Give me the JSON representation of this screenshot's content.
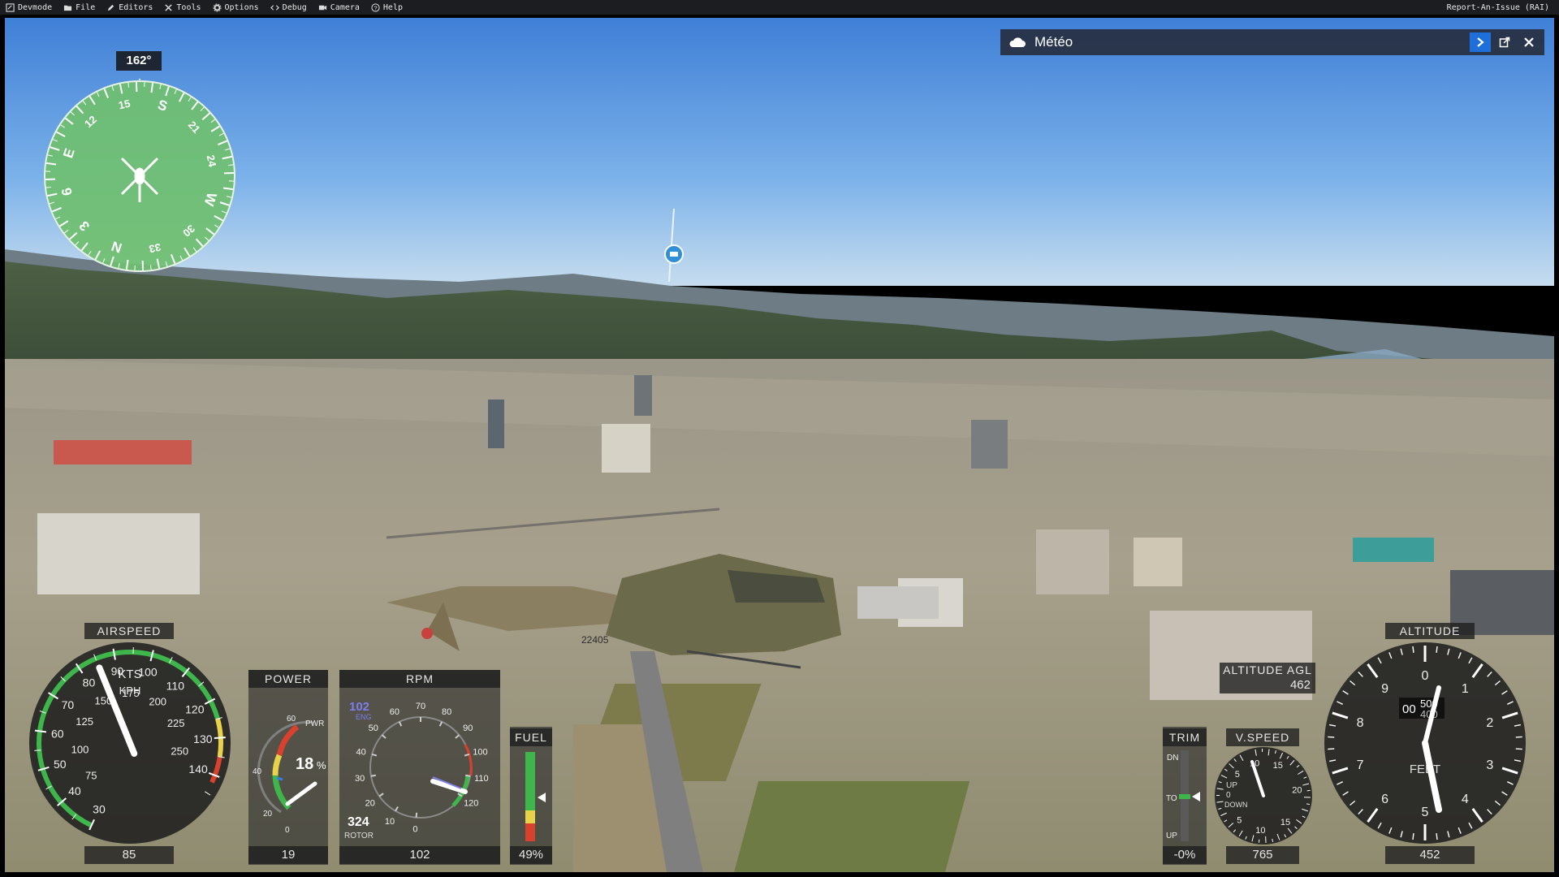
{
  "menu": {
    "items": [
      {
        "label": "Devmode",
        "icon": "devmode-icon"
      },
      {
        "label": "File",
        "icon": "folder-icon"
      },
      {
        "label": "Editors",
        "icon": "pencil-icon"
      },
      {
        "label": "Tools",
        "icon": "tools-icon"
      },
      {
        "label": "Options",
        "icon": "gear-icon"
      },
      {
        "label": "Debug",
        "icon": "code-icon"
      },
      {
        "label": "Camera",
        "icon": "camera-icon"
      },
      {
        "label": "Help",
        "icon": "help-icon"
      }
    ],
    "report": "Report-An-Issue (RAI)"
  },
  "weather_panel": {
    "title": "Météo",
    "icon": "cloud-icon"
  },
  "heading": {
    "value": "162°",
    "degrees": 162,
    "labels": [
      "N",
      "3",
      "6",
      "E",
      "12",
      "15",
      "S",
      "21",
      "24",
      "W",
      "30",
      "33"
    ]
  },
  "airspeed": {
    "label": "AIRSPEED",
    "value": "85",
    "unit1": "KTS",
    "unit2": "KPH",
    "kts_marks": [
      "30",
      "40",
      "50",
      "60",
      "70",
      "80",
      "90",
      "100",
      "110",
      "120",
      "130",
      "140"
    ],
    "kph_marks": [
      "75",
      "100",
      "125",
      "150",
      "175",
      "200",
      "225",
      "250"
    ],
    "needle_kts": 85
  },
  "power": {
    "label": "POWER",
    "pwr": "PWR",
    "percent": "18",
    "pct_sign": "%",
    "value": "19",
    "marks": [
      "0",
      "20",
      "40",
      "60"
    ]
  },
  "rpm": {
    "label": "RPM",
    "eng": "102",
    "eng_label": "ENG",
    "rotor": "324",
    "rotor_label": "ROTOR",
    "value": "102",
    "marks": [
      "0",
      "10",
      "20",
      "30",
      "40",
      "50",
      "60",
      "70",
      "80",
      "90",
      "100",
      "110",
      "120"
    ]
  },
  "fuel": {
    "label": "FUEL",
    "value": "49%",
    "level": 0.49
  },
  "trim": {
    "label": "TRIM",
    "dn": "DN",
    "to": "TO",
    "up": "UP",
    "value": "-0%"
  },
  "vspeed": {
    "label": "V.SPEED",
    "value": "765",
    "up": "UP",
    "down": "DOWN",
    "zero": "0",
    "marks": [
      "5",
      "10",
      "15",
      "20",
      "15",
      "10",
      "5"
    ]
  },
  "altitude_agl": {
    "label": "ALTITUDE AGL",
    "value": "462"
  },
  "altitude": {
    "label": "ALTITUDE",
    "value": "452",
    "unit": "FEET",
    "drum": "00",
    "drum_digits": "500",
    "drum_low": "400",
    "marks": [
      "0",
      "1",
      "2",
      "3",
      "4",
      "5",
      "6",
      "7",
      "8",
      "9"
    ]
  },
  "marker": {
    "icon": "poi-marker-icon"
  },
  "aircraft": {
    "tail": "22405"
  }
}
